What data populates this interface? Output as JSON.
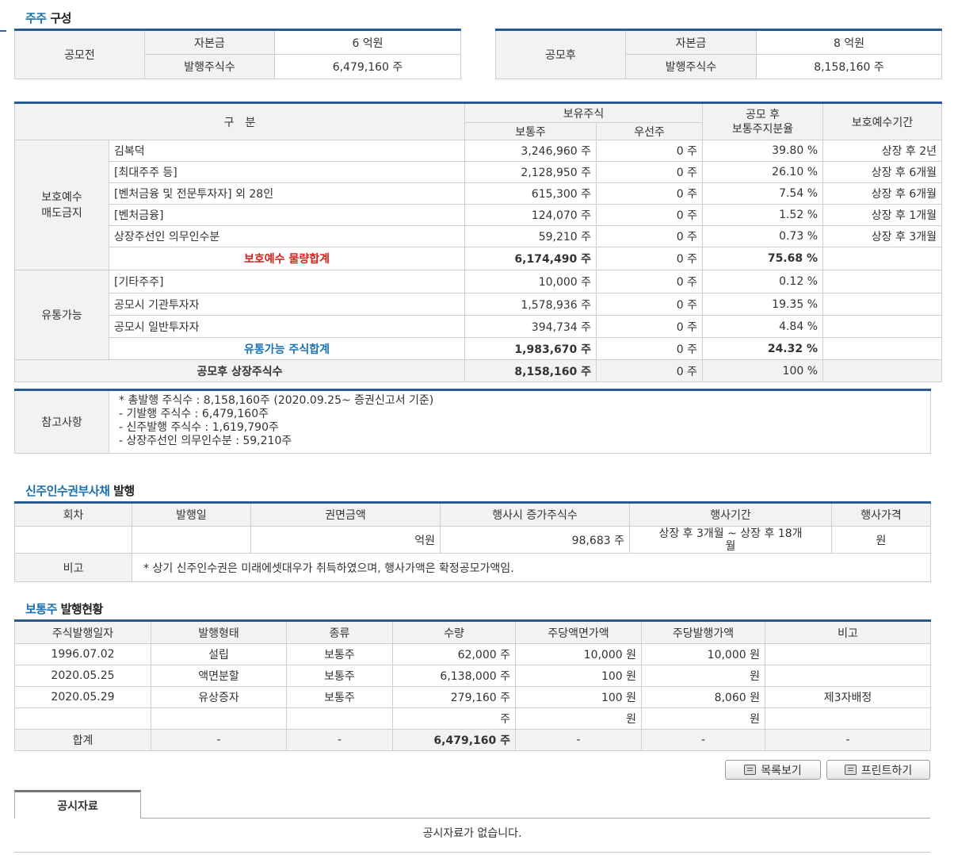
{
  "sections": {
    "shareholders": {
      "hl": "주주",
      "rest": " 구성"
    },
    "bw": {
      "hl": "신주인수권부사채",
      "rest": " 발행"
    },
    "common": {
      "hl": "보통주",
      "rest": " 발행현황"
    }
  },
  "before": {
    "label": "공모전",
    "capital_label": "자본금",
    "capital_value": "6 억원",
    "shares_label": "발행주식수",
    "shares_value": "6,479,160 주"
  },
  "after": {
    "label": "공모후",
    "capital_label": "자본금",
    "capital_value": "8 억원",
    "shares_label": "발행주식수",
    "shares_value": "8,158,160 주"
  },
  "holding": {
    "headers": {
      "category": "구　분",
      "held": "보유주식",
      "common": "보통주",
      "preferred": "우선주",
      "ratio_line1": "공모 후",
      "ratio_line2": "보통주지분율",
      "lockup": "보호예수기간"
    },
    "group_locked_line1": "보호예수",
    "group_locked_line2": "매도금지",
    "group_tradable": "유통가능",
    "locked_rows": [
      {
        "name": "김복덕",
        "common": "3,246,960 주",
        "pref": "0 주",
        "ratio": "39.80 %",
        "period": "상장 후 2년"
      },
      {
        "name": "[최대주주 등]",
        "common": "2,128,950 주",
        "pref": "0 주",
        "ratio": "26.10 %",
        "period": "상장 후 6개월"
      },
      {
        "name": "[벤처금융 및 전문투자자] 외 28인",
        "common": "615,300 주",
        "pref": "0 주",
        "ratio": "7.54 %",
        "period": "상장 후 6개월"
      },
      {
        "name": "[벤처금융]",
        "common": "124,070 주",
        "pref": "0 주",
        "ratio": "1.52 %",
        "period": "상장 후 1개월"
      },
      {
        "name": "상장주선인 의무인수분",
        "common": "59,210 주",
        "pref": "0 주",
        "ratio": "0.73 %",
        "period": "상장 후 3개월"
      }
    ],
    "locked_total": {
      "name": "보호예수 물량합계",
      "common": "6,174,490 주",
      "pref": "0 주",
      "ratio": "75.68 %"
    },
    "tradable_rows": [
      {
        "name": "[기타주주]",
        "common": "10,000 주",
        "pref": "0 주",
        "ratio": "0.12 %"
      },
      {
        "name": "공모시 기관투자자",
        "common": "1,578,936 주",
        "pref": "0 주",
        "ratio": "19.35 %"
      },
      {
        "name": "공모시 일반투자자",
        "common": "394,734 주",
        "pref": "0 주",
        "ratio": "4.84 %"
      }
    ],
    "tradable_total": {
      "name": "유통가능 주식합계",
      "common": "1,983,670 주",
      "pref": "0 주",
      "ratio": "24.32 %"
    },
    "listed_total": {
      "name": "공모후 상장주식수",
      "common": "8,158,160 주",
      "pref": "0 주",
      "ratio": "100 %"
    }
  },
  "notes": {
    "label": "참고사항",
    "lines": [
      "* 총발행 주식수 : 8,158,160주 (2020.09.25~ 증권신고서 기준)",
      "- 기발행 주식수 : 6,479,160주",
      "- 신주발행 주식수 : 1,619,790주",
      "- 상장주선인 의무인수분 : 59,210주"
    ]
  },
  "bw_table": {
    "headers": [
      "회차",
      "발행일",
      "권면금액",
      "행사시 증가주식수",
      "행사기간",
      "행사가격"
    ],
    "row": {
      "no": "",
      "date": "",
      "amount": "억원",
      "increase": "98,683 주",
      "period_line1": "상장 후 3개월 ~ 상장 후 18개",
      "period_line2": "월",
      "price": "원"
    },
    "remark_label": "비고",
    "remark": "* 상기 신주인수권은 미래에셋대우가 취득하였으며, 행사가액은 확정공모가액임."
  },
  "common_table": {
    "headers": [
      "주식발행일자",
      "발행형태",
      "종류",
      "수량",
      "주당액면가액",
      "주당발행가액",
      "비고"
    ],
    "rows": [
      [
        "1996.07.02",
        "설립",
        "보통주",
        "62,000 주",
        "10,000 원",
        "10,000 원",
        ""
      ],
      [
        "2020.05.25",
        "액면분할",
        "보통주",
        "6,138,000 주",
        "100 원",
        "원",
        ""
      ],
      [
        "2020.05.29",
        "유상증자",
        "보통주",
        "279,160 주",
        "100 원",
        "8,060 원",
        "제3자배정"
      ],
      [
        "",
        "",
        "",
        "주",
        "원",
        "원",
        ""
      ]
    ],
    "total": [
      "합계",
      "-",
      "-",
      "6,479,160 주",
      "-",
      "-",
      "-"
    ]
  },
  "buttons": {
    "list": "목록보기",
    "print": "프린트하기"
  },
  "disclosure": {
    "tab": "공시자료",
    "empty": "공시자료가 없습니다."
  }
}
